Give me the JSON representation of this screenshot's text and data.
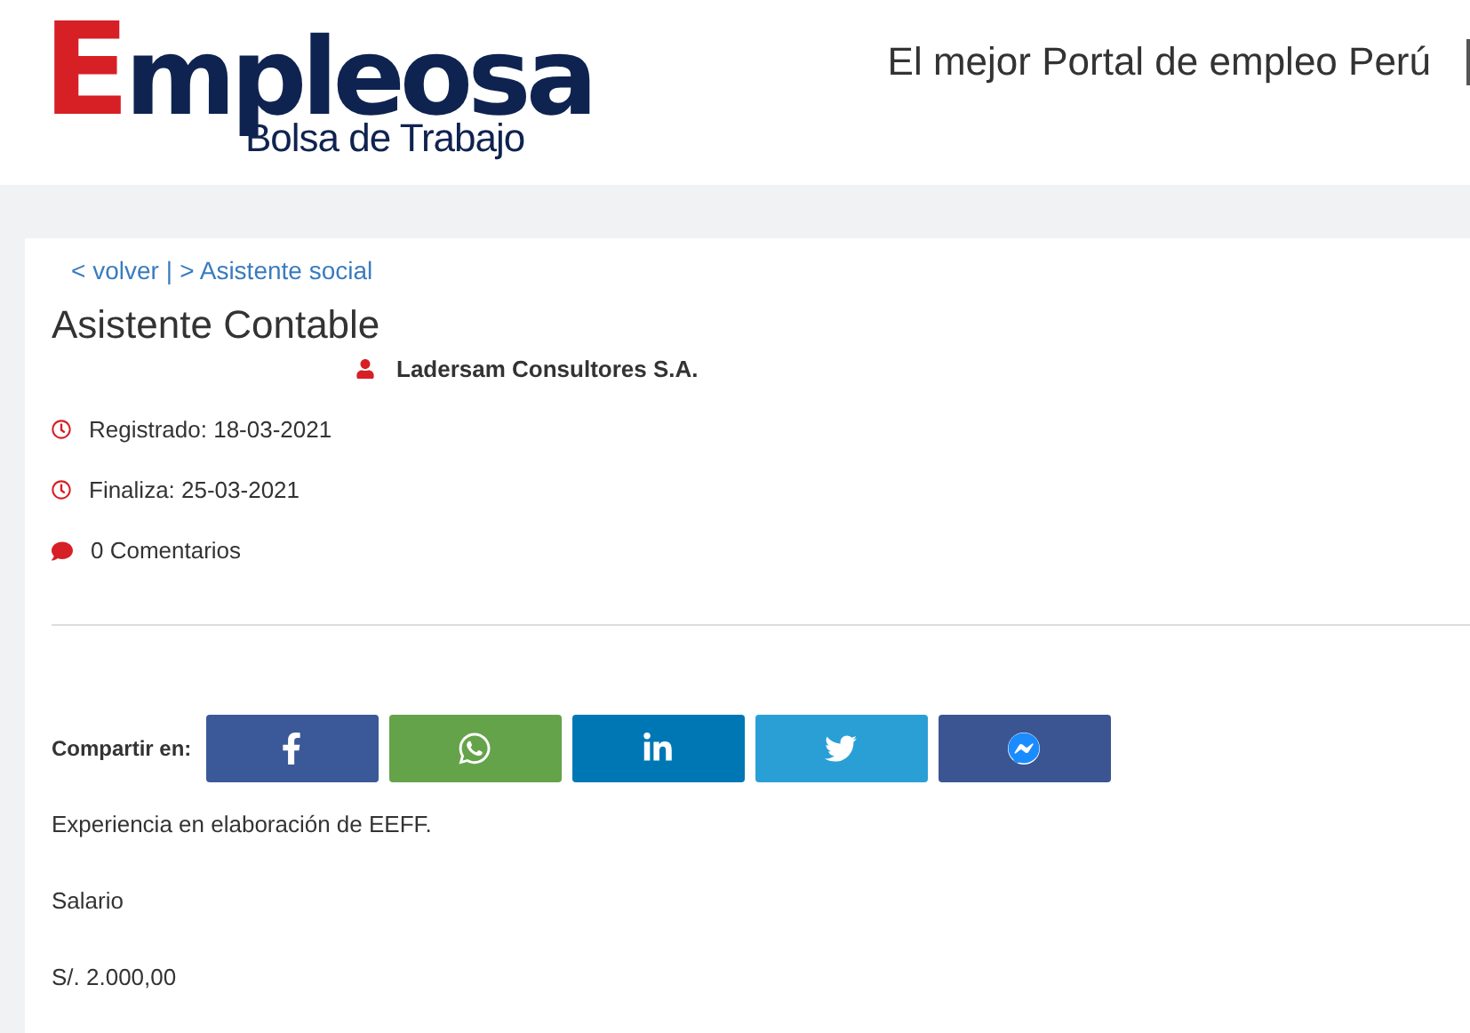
{
  "header": {
    "logo": {
      "initial": "E",
      "rest": "mpleosa",
      "subtitle": "Bolsa de Trabajo"
    },
    "tagline": "El mejor Portal de empleo Perú"
  },
  "breadcrumb": {
    "back": "< volver",
    "separator": "|",
    "current": "> Asistente social"
  },
  "job": {
    "title": "Asistente Contable",
    "company": "Ladersam Consultores S.A.",
    "meta": [
      {
        "kind": "clock",
        "text": "Registrado: 18-03-2021"
      },
      {
        "kind": "clock",
        "text": "Finaliza: 25-03-2021"
      },
      {
        "kind": "comment",
        "text": "0 Comentarios"
      }
    ]
  },
  "share": {
    "label": "Compartir en:",
    "buttons": [
      {
        "kind": "facebook"
      },
      {
        "kind": "whatsapp"
      },
      {
        "kind": "linkedin"
      },
      {
        "kind": "twitter"
      },
      {
        "kind": "messenger"
      }
    ]
  },
  "description": [
    "Experiencia en elaboración de EEFF.",
    "Salario",
    "S/. 2.000,00"
  ]
}
